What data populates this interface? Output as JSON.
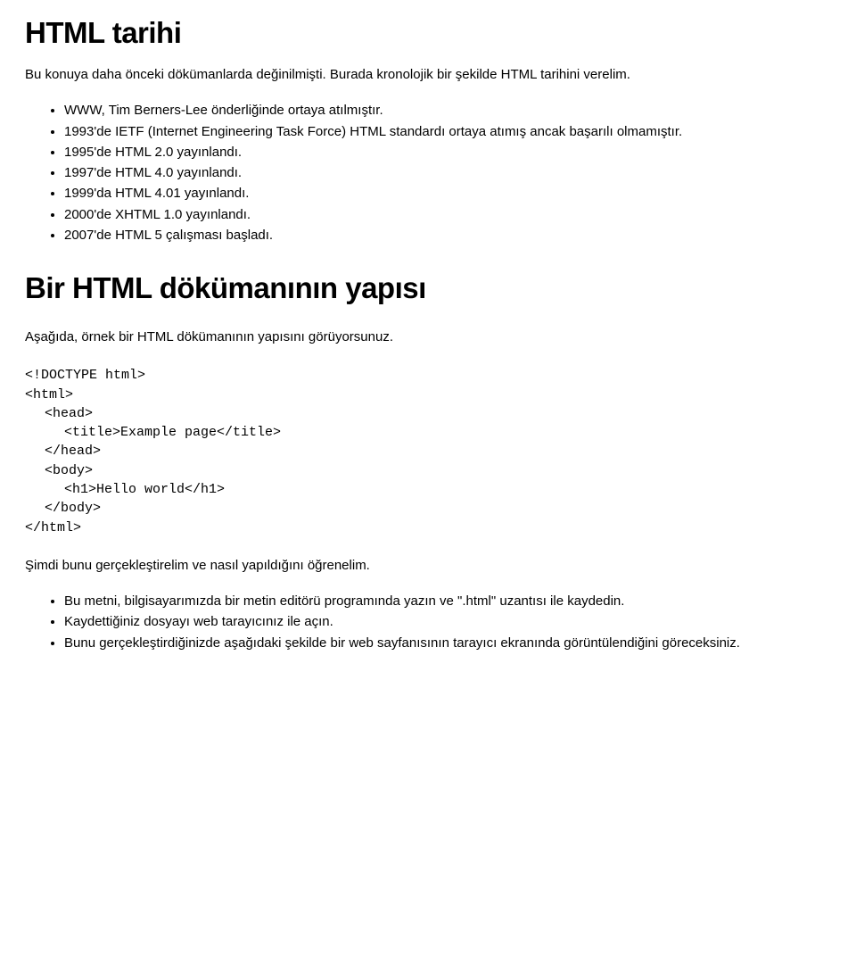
{
  "title1": "HTML tarihi",
  "intro1": "Bu konuya daha önceki dökümanlarda değinilmişti. Burada kronolojik bir şekilde HTML tarihini verelim.",
  "history": [
    "WWW, Tim Berners-Lee önderliğinde ortaya atılmıştır.",
    "1993'de IETF (Internet Engineering Task Force) HTML standardı ortaya atımış ancak başarılı olmamıştır.",
    "1995'de HTML 2.0 yayınlandı.",
    "1997'de HTML 4.0 yayınlandı.",
    "1999'da HTML 4.01 yayınlandı.",
    "2000'de XHTML 1.0 yayınlandı.",
    "2007'de HTML 5 çalışması başladı."
  ],
  "title2": "Bir HTML dökümanının yapısı",
  "intro2": "Aşağıda, örnek bir HTML dökümanının yapısını görüyorsunuz.",
  "code": {
    "l1": "<!DOCTYPE html>",
    "l2": "<html>",
    "l3": "<head>",
    "l4": "<title>Example page</title>",
    "l5": "</head>",
    "l6": "<body>",
    "l7": "<h1>Hello world</h1>",
    "l8": "</body>",
    "l9": "</html>"
  },
  "followup": "Şimdi bunu gerçekleştirelim ve nasıl yapıldığını öğrenelim.",
  "steps": [
    "Bu metni, bilgisayarımızda bir metin editörü programında yazın ve \".html\" uzantısı ile kaydedin.",
    "Kaydettiğiniz dosyayı web tarayıcınız ile açın.",
    "Bunu gerçekleştirdiğinizde aşağıdaki şekilde bir web sayfanısının tarayıcı ekranında görüntülendiğini göreceksiniz."
  ]
}
